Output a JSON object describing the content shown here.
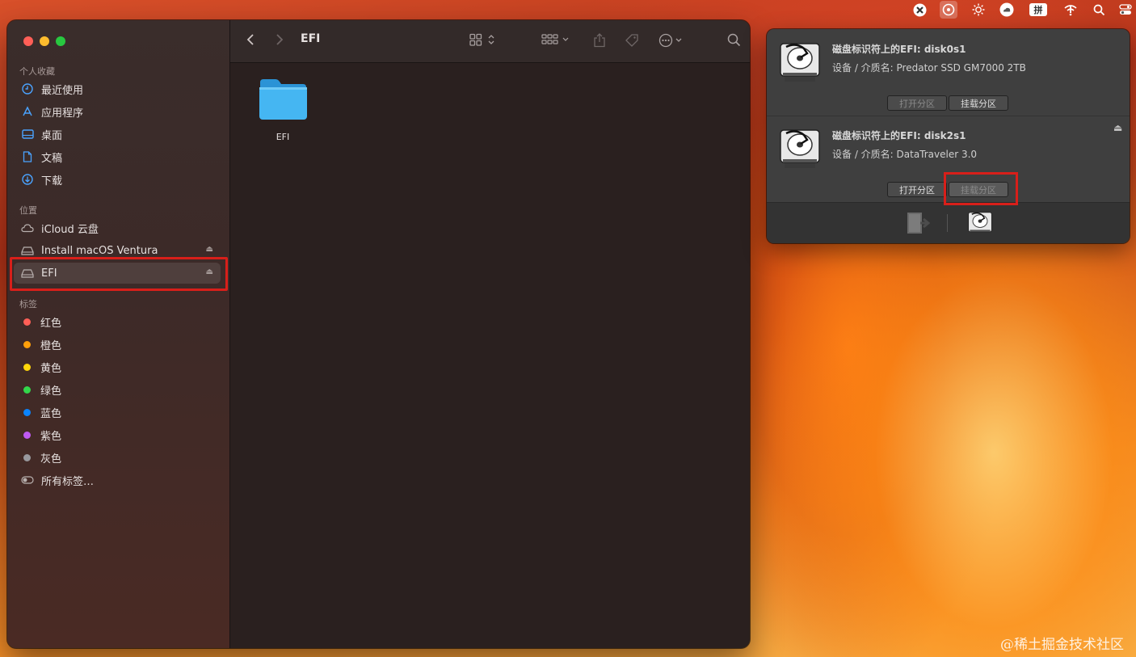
{
  "menubar": {
    "icons": [
      "xmark-app-icon",
      "disk-mounter-icon",
      "brightness-icon",
      "cloud-icon",
      "input-method-icon",
      "wifi-icon",
      "search-icon",
      "control-center-icon"
    ],
    "input_method_label": "拼"
  },
  "finder": {
    "window_title": "EFI",
    "sidebar": {
      "favorites_label": "个人收藏",
      "favorites": [
        {
          "label": "最近使用",
          "icon": "clock-icon"
        },
        {
          "label": "应用程序",
          "icon": "applications-icon"
        },
        {
          "label": "桌面",
          "icon": "desktop-icon"
        },
        {
          "label": "文稿",
          "icon": "document-icon"
        },
        {
          "label": "下载",
          "icon": "download-icon"
        }
      ],
      "locations_label": "位置",
      "locations": [
        {
          "label": "iCloud 云盘",
          "icon": "cloud-icon"
        },
        {
          "label": "Install macOS Ventura",
          "icon": "drive-icon"
        },
        {
          "label": "EFI",
          "icon": "drive-icon",
          "selected": true
        }
      ],
      "tags_label": "标签",
      "tags": [
        {
          "label": "红色",
          "color": "#ff5f57"
        },
        {
          "label": "橙色",
          "color": "#ff9f0a"
        },
        {
          "label": "黄色",
          "color": "#ffd60a"
        },
        {
          "label": "绿色",
          "color": "#32d74b"
        },
        {
          "label": "蓝色",
          "color": "#0a84ff"
        },
        {
          "label": "紫色",
          "color": "#bf5af2"
        },
        {
          "label": "灰色",
          "color": "#98989d"
        }
      ],
      "all_tags_label": "所有标签…"
    },
    "content": {
      "items": [
        {
          "name": "EFI",
          "type": "folder",
          "color": "#3fb0ee"
        }
      ]
    }
  },
  "popup": {
    "disks": [
      {
        "title": "磁盘标识符上的EFI: disk0s1",
        "subtitle": "设备 / 介质名: Predator SSD GM7000 2TB",
        "open_label": "打开分区",
        "mount_label": "挂载分区"
      },
      {
        "title": "磁盘标识符上的EFI: disk2s1",
        "subtitle": "设备 / 介质名: DataTraveler 3.0",
        "open_label": "打开分区",
        "mount_label": "挂载分区"
      }
    ]
  },
  "watermark": "@稀土掘金技术社区"
}
